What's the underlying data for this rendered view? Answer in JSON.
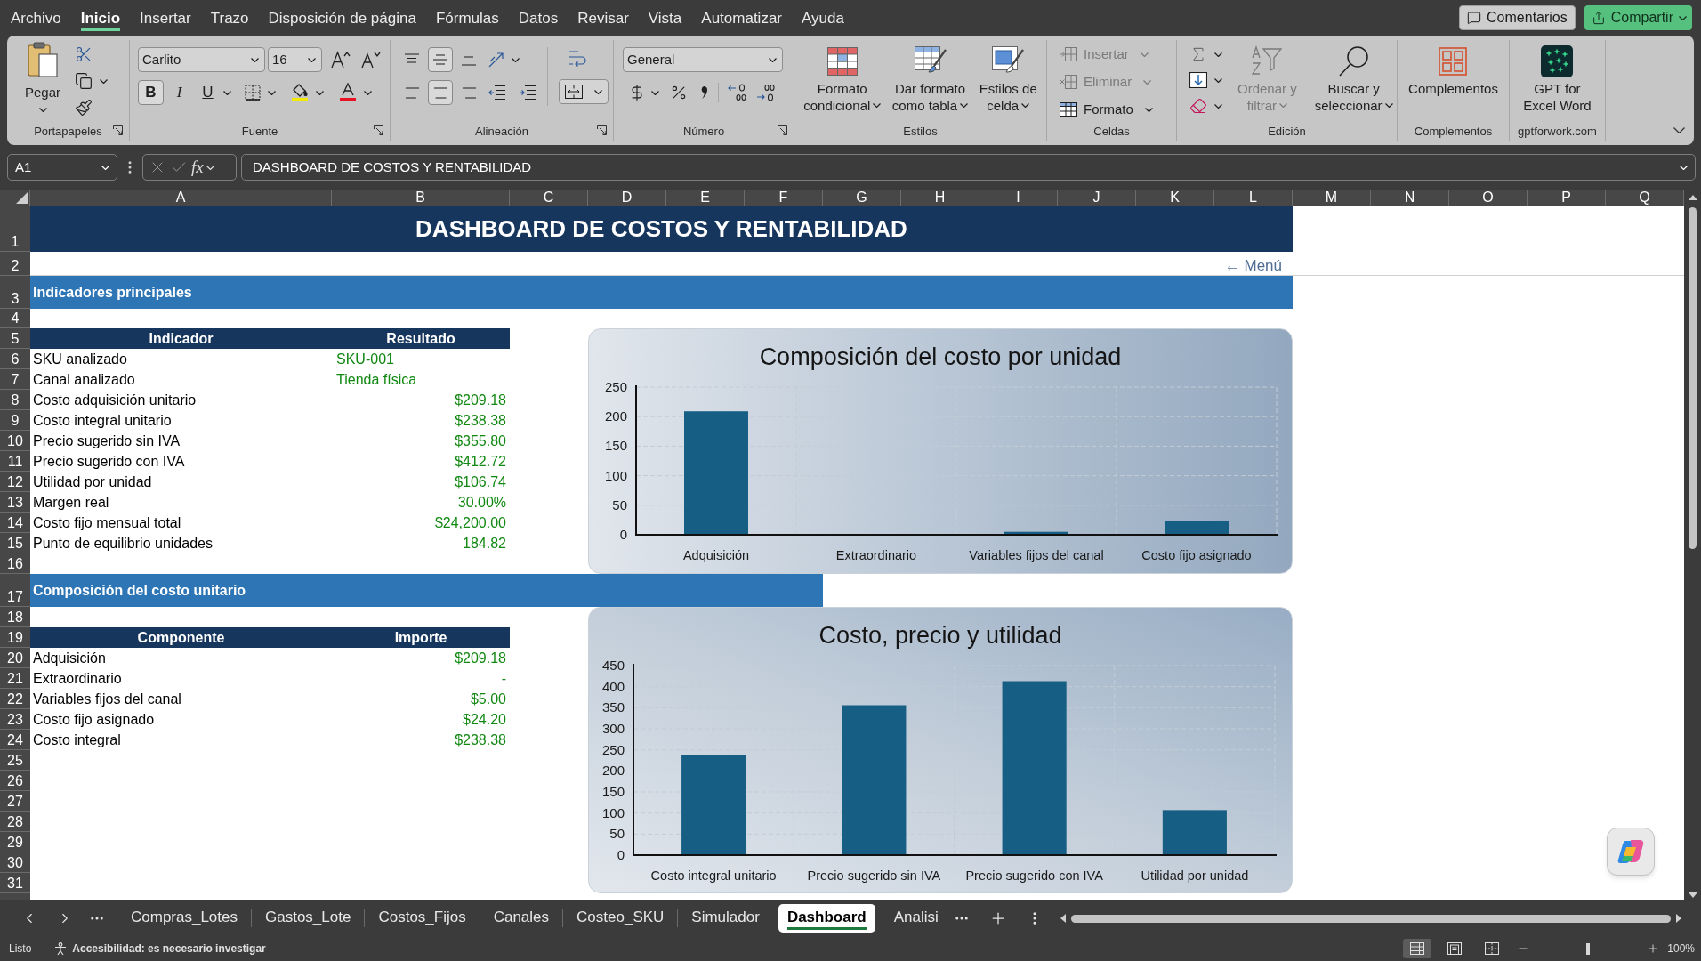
{
  "menu_bar": {
    "tabs": [
      {
        "label": "Archivo",
        "selected": false
      },
      {
        "label": "Inicio",
        "selected": true
      },
      {
        "label": "Insertar",
        "selected": false
      },
      {
        "label": "Trazo",
        "selected": false
      },
      {
        "label": "Disposición de página",
        "selected": false
      },
      {
        "label": "Fórmulas",
        "selected": false
      },
      {
        "label": "Datos",
        "selected": false
      },
      {
        "label": "Revisar",
        "selected": false
      },
      {
        "label": "Vista",
        "selected": false
      },
      {
        "label": "Automatizar",
        "selected": false
      },
      {
        "label": "Ayuda",
        "selected": false
      }
    ],
    "comments_button": "Comentarios",
    "share_button": "Compartir"
  },
  "ribbon": {
    "clipboard": {
      "paste": "Pegar",
      "group_label": "Portapapeles"
    },
    "font": {
      "font_name": "Carlito",
      "font_size": "16",
      "styles": [
        {
          "kind": "bold",
          "label": "B",
          "selected": true
        },
        {
          "kind": "italic",
          "label": "I",
          "selected": false
        },
        {
          "kind": "underline",
          "label": "U",
          "selected": false
        }
      ],
      "group_label": "Fuente"
    },
    "alignment": {
      "vertical": [
        {
          "kind": "top",
          "selected": false
        },
        {
          "kind": "middle",
          "selected": true
        },
        {
          "kind": "bottom",
          "selected": false
        }
      ],
      "horizontal": [
        {
          "kind": "left",
          "selected": false
        },
        {
          "kind": "center",
          "selected": true
        },
        {
          "kind": "right",
          "selected": false
        }
      ],
      "group_label": "Alineación"
    },
    "number": {
      "format": "General",
      "group_label": "Número"
    },
    "styles": {
      "buttons": [
        {
          "kind": "conditional",
          "lines": [
            "Formato",
            "condicional"
          ]
        },
        {
          "kind": "table",
          "lines": [
            "Dar formato",
            "como tabla"
          ]
        },
        {
          "kind": "cell",
          "lines": [
            "Estilos de",
            "celda"
          ]
        }
      ],
      "group_label": "Estilos"
    },
    "cells": {
      "buttons": [
        {
          "kind": "insert",
          "label": "Insertar",
          "disabled": true
        },
        {
          "kind": "delete",
          "label": "Eliminar",
          "disabled": true
        },
        {
          "kind": "format",
          "label": "Formato",
          "disabled": false
        }
      ],
      "group_label": "Celdas"
    },
    "editing": {
      "buttons": [
        {
          "kind": "sort",
          "lines": [
            "Ordenar y",
            "filtrar"
          ],
          "disabled": true
        },
        {
          "kind": "find",
          "lines": [
            "Buscar y",
            "seleccionar"
          ],
          "disabled": false
        }
      ],
      "group_label": "Edición"
    },
    "addins": {
      "button": "Complementos",
      "group_label": "Complementos"
    },
    "gpt": {
      "lines": [
        "GPT for",
        "Excel Word"
      ],
      "group_label": "gptforwork.com"
    }
  },
  "formula_bar": {
    "name_box": "A1",
    "function_button": "fx",
    "formula": "DASHBOARD DE COSTOS Y RENTABILIDAD"
  },
  "sheet": {
    "columns": [
      "A",
      "B",
      "C",
      "D",
      "E",
      "F",
      "G",
      "H",
      "I",
      "J",
      "K",
      "L",
      "M",
      "N",
      "O",
      "P",
      "Q"
    ],
    "rows": [
      "1",
      "2",
      "3",
      "4",
      "5",
      "6",
      "7",
      "8",
      "9",
      "10",
      "11",
      "12",
      "13",
      "14",
      "15",
      "16",
      "17",
      "18",
      "19",
      "20",
      "21",
      "22",
      "23",
      "24",
      "25",
      "26",
      "27",
      "28",
      "29",
      "30",
      "31"
    ],
    "title": "DASHBOARD DE COSTOS Y RENTABILIDAD",
    "menu_link": "← Menú",
    "indicators": {
      "heading": "Indicadores principales",
      "columns": [
        "Indicador",
        "Resultado"
      ],
      "rows": [
        {
          "label": "SKU analizado",
          "value": "SKU-001",
          "kind": "text"
        },
        {
          "label": "Canal analizado",
          "value": "Tienda física",
          "kind": "text"
        },
        {
          "label": "Costo adquisición unitario",
          "value": "$209.18",
          "kind": "number"
        },
        {
          "label": "Costo integral unitario",
          "value": "$238.38",
          "kind": "number"
        },
        {
          "label": "Precio sugerido sin IVA",
          "value": "$355.80",
          "kind": "number"
        },
        {
          "label": "Precio sugerido con IVA",
          "value": "$412.72",
          "kind": "number"
        },
        {
          "label": "Utilidad por unidad",
          "value": "$106.74",
          "kind": "number"
        },
        {
          "label": "Margen real",
          "value": "30.00%",
          "kind": "number"
        },
        {
          "label": "Costo fijo mensual total",
          "value": "$24,200.00",
          "kind": "number"
        },
        {
          "label": "Punto de equilibrio unidades",
          "value": "184.82",
          "kind": "number"
        }
      ]
    },
    "composition": {
      "heading": "Composición del costo unitario",
      "columns": [
        "Componente",
        "Importe"
      ],
      "rows": [
        {
          "label": "Adquisición",
          "value": "$209.18",
          "kind": "number"
        },
        {
          "label": "Extraordinario",
          "value": "-",
          "kind": "number"
        },
        {
          "label": "Variables fijos del canal",
          "value": "$5.00",
          "kind": "number"
        },
        {
          "label": "Costo fijo asignado",
          "value": "$24.20",
          "kind": "number"
        },
        {
          "label": "Costo integral",
          "value": "$238.38",
          "kind": "number"
        }
      ]
    },
    "charts": [
      {
        "chart_data": {
          "type": "bar",
          "title": "Composición del costo por unidad",
          "categories": [
            "Adquisición",
            "Extraordinario",
            "Variables fijos del canal",
            "Costo fijo asignado"
          ],
          "series": [
            {
              "color": "#175e84",
              "values": [
                209,
                0,
                5,
                24
              ]
            }
          ],
          "ylim": [
            0,
            250
          ],
          "yticks": [
            0,
            50,
            100,
            150,
            200,
            250
          ],
          "grid": true
        }
      },
      {
        "chart_data": {
          "type": "bar",
          "title": "Costo, precio y utilidad",
          "categories": [
            "Costo integral unitario",
            "Precio sugerido sin IVA",
            "Precio sugerido con IVA",
            "Utilidad por unidad"
          ],
          "series": [
            {
              "color": "#175e84",
              "values": [
                238,
                356,
                413,
                107
              ]
            }
          ],
          "ylim": [
            0,
            450
          ],
          "yticks": [
            0,
            50,
            100,
            150,
            200,
            250,
            300,
            350,
            400,
            450
          ],
          "grid": true
        }
      }
    ]
  },
  "sheet_tabs": [
    {
      "label": "Compras_Lotes",
      "selected": false
    },
    {
      "label": "Gastos_Lote",
      "selected": false
    },
    {
      "label": "Costos_Fijos",
      "selected": false
    },
    {
      "label": "Canales",
      "selected": false
    },
    {
      "label": "Costeo_SKU",
      "selected": false
    },
    {
      "label": "Simulador",
      "selected": false
    },
    {
      "label": "Dashboard",
      "selected": true
    },
    {
      "label": "Analisi",
      "selected": false
    }
  ],
  "status_bar": {
    "ready": "Listo",
    "accessibility": "Accesibilidad: es necesario investigar",
    "views": [
      {
        "kind": "normal",
        "selected": true
      },
      {
        "kind": "page_layout",
        "selected": false
      },
      {
        "kind": "page_break_preview",
        "selected": false
      }
    ],
    "zoom": {
      "level": 0.5,
      "reading": "100%"
    }
  }
}
